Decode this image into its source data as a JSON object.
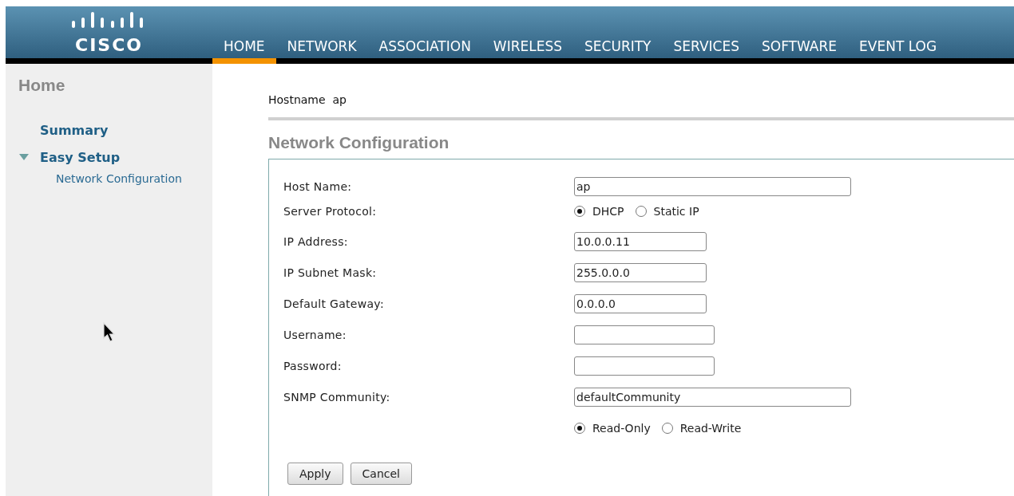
{
  "logo": {
    "text": "CISCO"
  },
  "nav": [
    {
      "label": "HOME",
      "selected": true
    },
    {
      "label": "NETWORK",
      "selected": false
    },
    {
      "label": "ASSOCIATION",
      "selected": false
    },
    {
      "label": "WIRELESS",
      "selected": false
    },
    {
      "label": "SECURITY",
      "selected": false
    },
    {
      "label": "SERVICES",
      "selected": false
    },
    {
      "label": "SOFTWARE",
      "selected": false
    },
    {
      "label": "EVENT LOG",
      "selected": false
    }
  ],
  "sidebar": {
    "title": "Home",
    "items": [
      {
        "label": "Summary"
      },
      {
        "label": "Easy Setup",
        "expanded": true,
        "children": [
          {
            "label": "Network Configuration"
          }
        ]
      }
    ]
  },
  "hostname": {
    "label": "Hostname",
    "value": "ap"
  },
  "section_title": "Network Configuration",
  "form": {
    "rows": [
      {
        "kind": "longtext",
        "label": "Host Name:",
        "value": "ap"
      },
      {
        "kind": "radio",
        "label": "Server Protocol:",
        "options": [
          {
            "label": "DHCP",
            "selected": true
          },
          {
            "label": "Static IP",
            "selected": false
          }
        ]
      },
      {
        "kind": "shorttext",
        "label": "IP Address:",
        "value": "10.0.0.11"
      },
      {
        "kind": "shorttext",
        "label": "IP Subnet Mask:",
        "value": "255.0.0.0"
      },
      {
        "kind": "shorttext",
        "label": "Default Gateway:",
        "value": "0.0.0.0"
      },
      {
        "kind": "text",
        "label": "Username:"
      },
      {
        "kind": "password",
        "label": "Password:"
      },
      {
        "kind": "longtext",
        "label": "SNMP Community:",
        "value": "defaultCommunity"
      },
      {
        "kind": "radio",
        "options": [
          {
            "label": "Read-Only",
            "selected": true
          },
          {
            "label": "Read-Write",
            "selected": false
          }
        ]
      }
    ],
    "buttons": [
      "Apply",
      "Cancel"
    ]
  }
}
